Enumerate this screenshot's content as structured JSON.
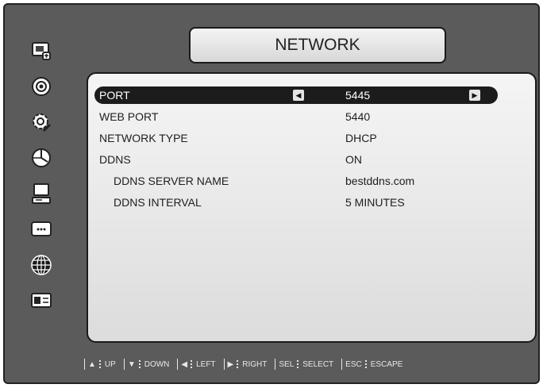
{
  "title": "NETWORK",
  "sidebar": {
    "icons": [
      "camera-settings-icon",
      "record-icon",
      "system-settings-icon",
      "schedule-icon",
      "computer-icon",
      "display-icon",
      "network-globe-icon",
      "device-icon"
    ]
  },
  "settings": [
    {
      "label": "PORT",
      "value": "5445",
      "selected": true
    },
    {
      "label": "WEB PORT",
      "value": "5440"
    },
    {
      "label": "NETWORK TYPE",
      "value": "DHCP"
    },
    {
      "label": "DDNS",
      "value": "ON"
    },
    {
      "label": "DDNS SERVER NAME",
      "value": "bestddns.com",
      "sub": true
    },
    {
      "label": "DDNS INTERVAL",
      "value": "5 MINUTES",
      "sub": true
    }
  ],
  "footer": [
    {
      "key": "▲",
      "label": "UP"
    },
    {
      "key": "▼",
      "label": "DOWN"
    },
    {
      "key": "◀",
      "label": "LEFT"
    },
    {
      "key": "▶",
      "label": "RIGHT"
    },
    {
      "key": "SEL",
      "label": "SELECT"
    },
    {
      "key": "ESC",
      "label": "ESCAPE"
    }
  ]
}
